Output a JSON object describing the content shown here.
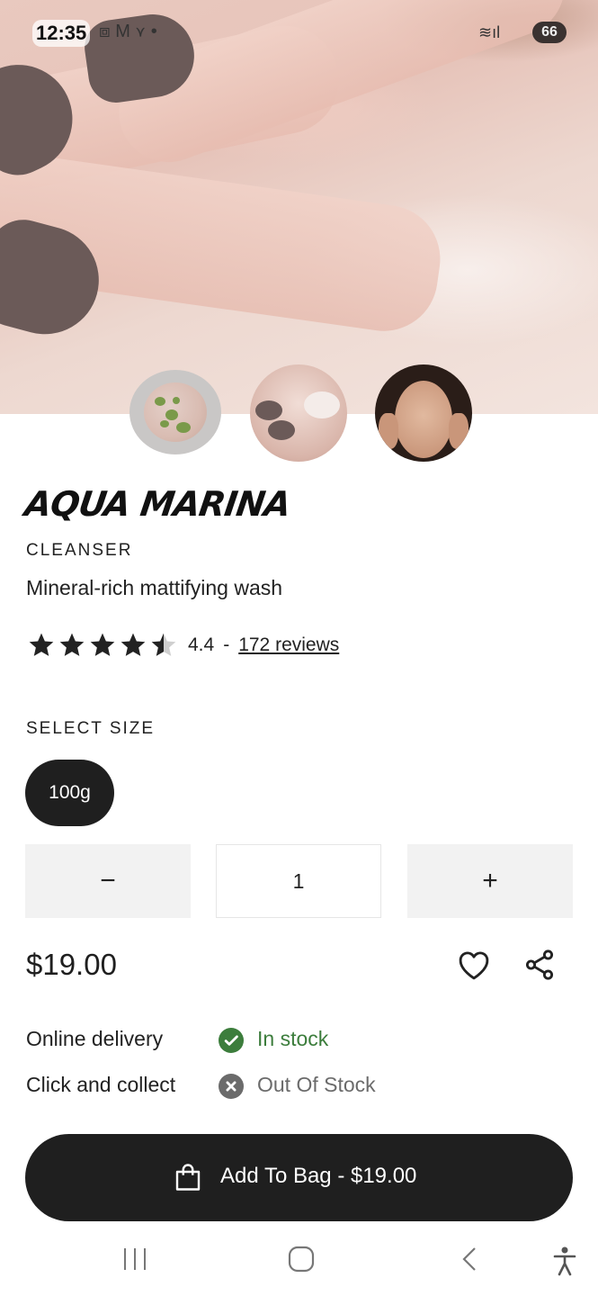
{
  "status_bar": {
    "time": "12:35",
    "battery": "66"
  },
  "product": {
    "name": "AQUA MARINA",
    "category": "CLEANSER",
    "description": "Mineral-rich mattifying wash",
    "rating": "4.4",
    "rating_separator": "-",
    "reviews_link": "172 reviews",
    "rating_stars_fraction": 0.88
  },
  "size": {
    "label": "SELECT SIZE",
    "options": [
      "100g"
    ],
    "selected": "100g"
  },
  "quantity": {
    "minus": "−",
    "value": "1",
    "plus": "+"
  },
  "price": "$19.00",
  "availability": [
    {
      "label": "Online delivery",
      "status": "In stock",
      "color": "#3c7d3c",
      "icon": "check-circle-icon"
    },
    {
      "label": "Click and collect",
      "status": "Out Of Stock",
      "color": "#6b6b6b",
      "icon": "x-circle-icon"
    }
  ],
  "add_to_bag": {
    "label": "Add To Bag - $19.00"
  },
  "colors": {
    "dark": "#1f1f1f",
    "secondary_bg": "#f2f2f2",
    "in_stock": "#3c7d3c"
  }
}
